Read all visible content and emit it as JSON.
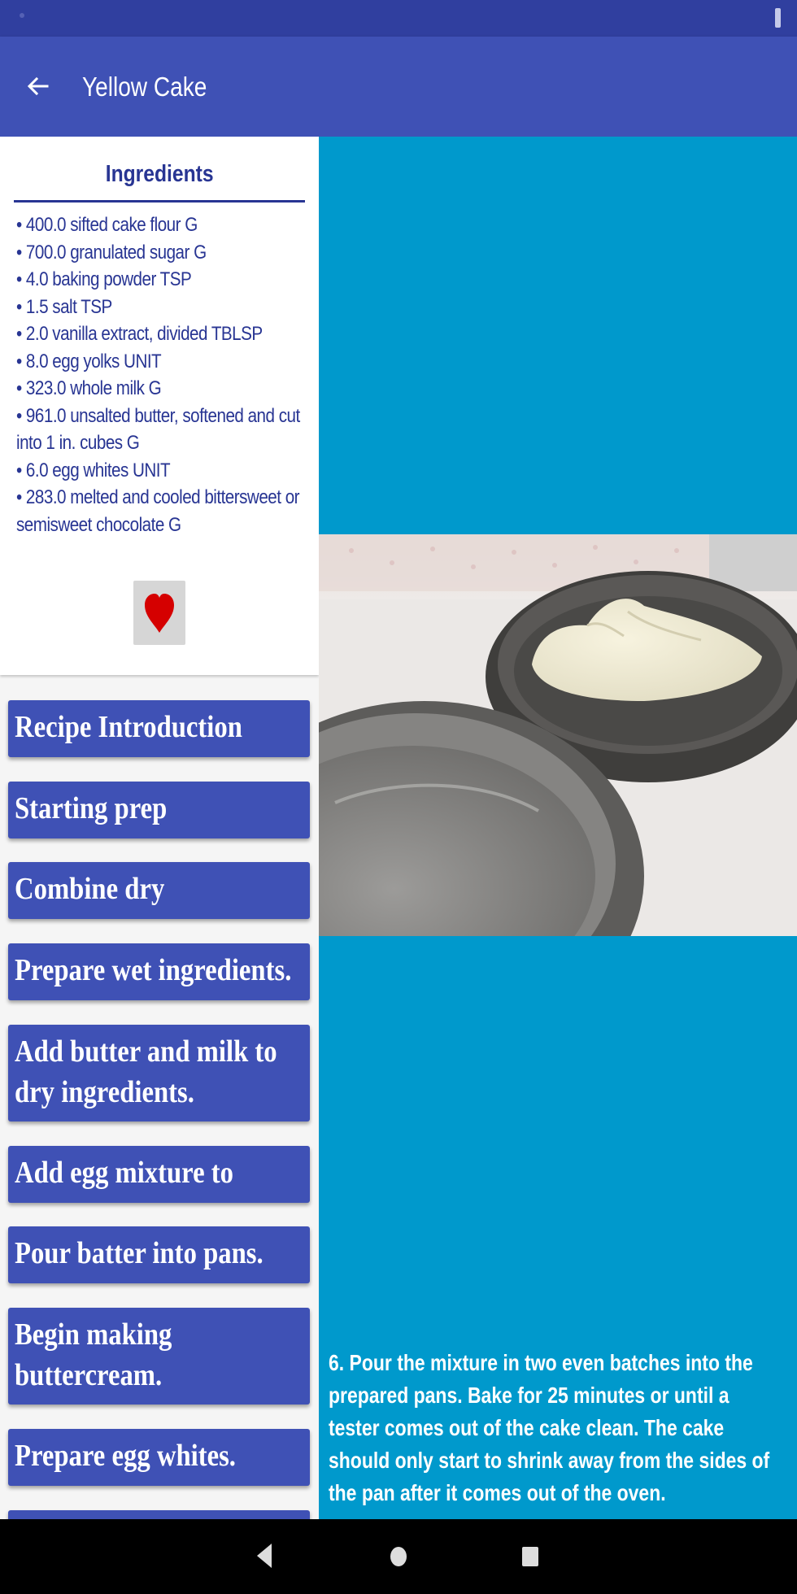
{
  "app_bar": {
    "title": "Yellow Cake",
    "back_icon": "arrow-back-icon",
    "color": "#3f51b5",
    "status_color": "#303f9f"
  },
  "ingredients": {
    "heading": "Ingredients",
    "items": [
      "• 400.0 sifted cake flour G",
      "• 700.0 granulated sugar G",
      "• 4.0 baking powder TSP",
      "• 1.5 salt TSP",
      "• 2.0 vanilla extract, divided TBLSP",
      "• 8.0 egg yolks UNIT",
      "• 323.0 whole milk G",
      "• 961.0 unsalted butter, softened and cut",
      "into 1 in. cubes G",
      "• 6.0 egg whites UNIT",
      "• 283.0 melted and cooled bittersweet or",
      "semisweet chocolate G"
    ],
    "favorite_icon": "heart-icon",
    "favorite_color": "#d50000"
  },
  "steps": [
    {
      "label": "Recipe Introduction"
    },
    {
      "label": "Starting prep"
    },
    {
      "label": "Combine dry"
    },
    {
      "label": "Prepare wet ingredients."
    },
    {
      "label": "Add butter and milk to dry ingredients."
    },
    {
      "label": "Add egg mixture to"
    },
    {
      "label": "Pour batter into pans."
    },
    {
      "label": "Begin making buttercream."
    },
    {
      "label": "Prepare egg whites."
    }
  ],
  "detail": {
    "background": "#0099cc",
    "description": "6. Pour the mixture in two even batches into the prepared pans. Bake for 25 minutes or until a tester comes out of the cake clean. The cake should only start to shrink away from the sides of the pan after it comes out of the oven."
  },
  "nav": {
    "back_icon": "nav-back-icon",
    "home_icon": "nav-home-icon",
    "recents_icon": "nav-recents-icon"
  }
}
